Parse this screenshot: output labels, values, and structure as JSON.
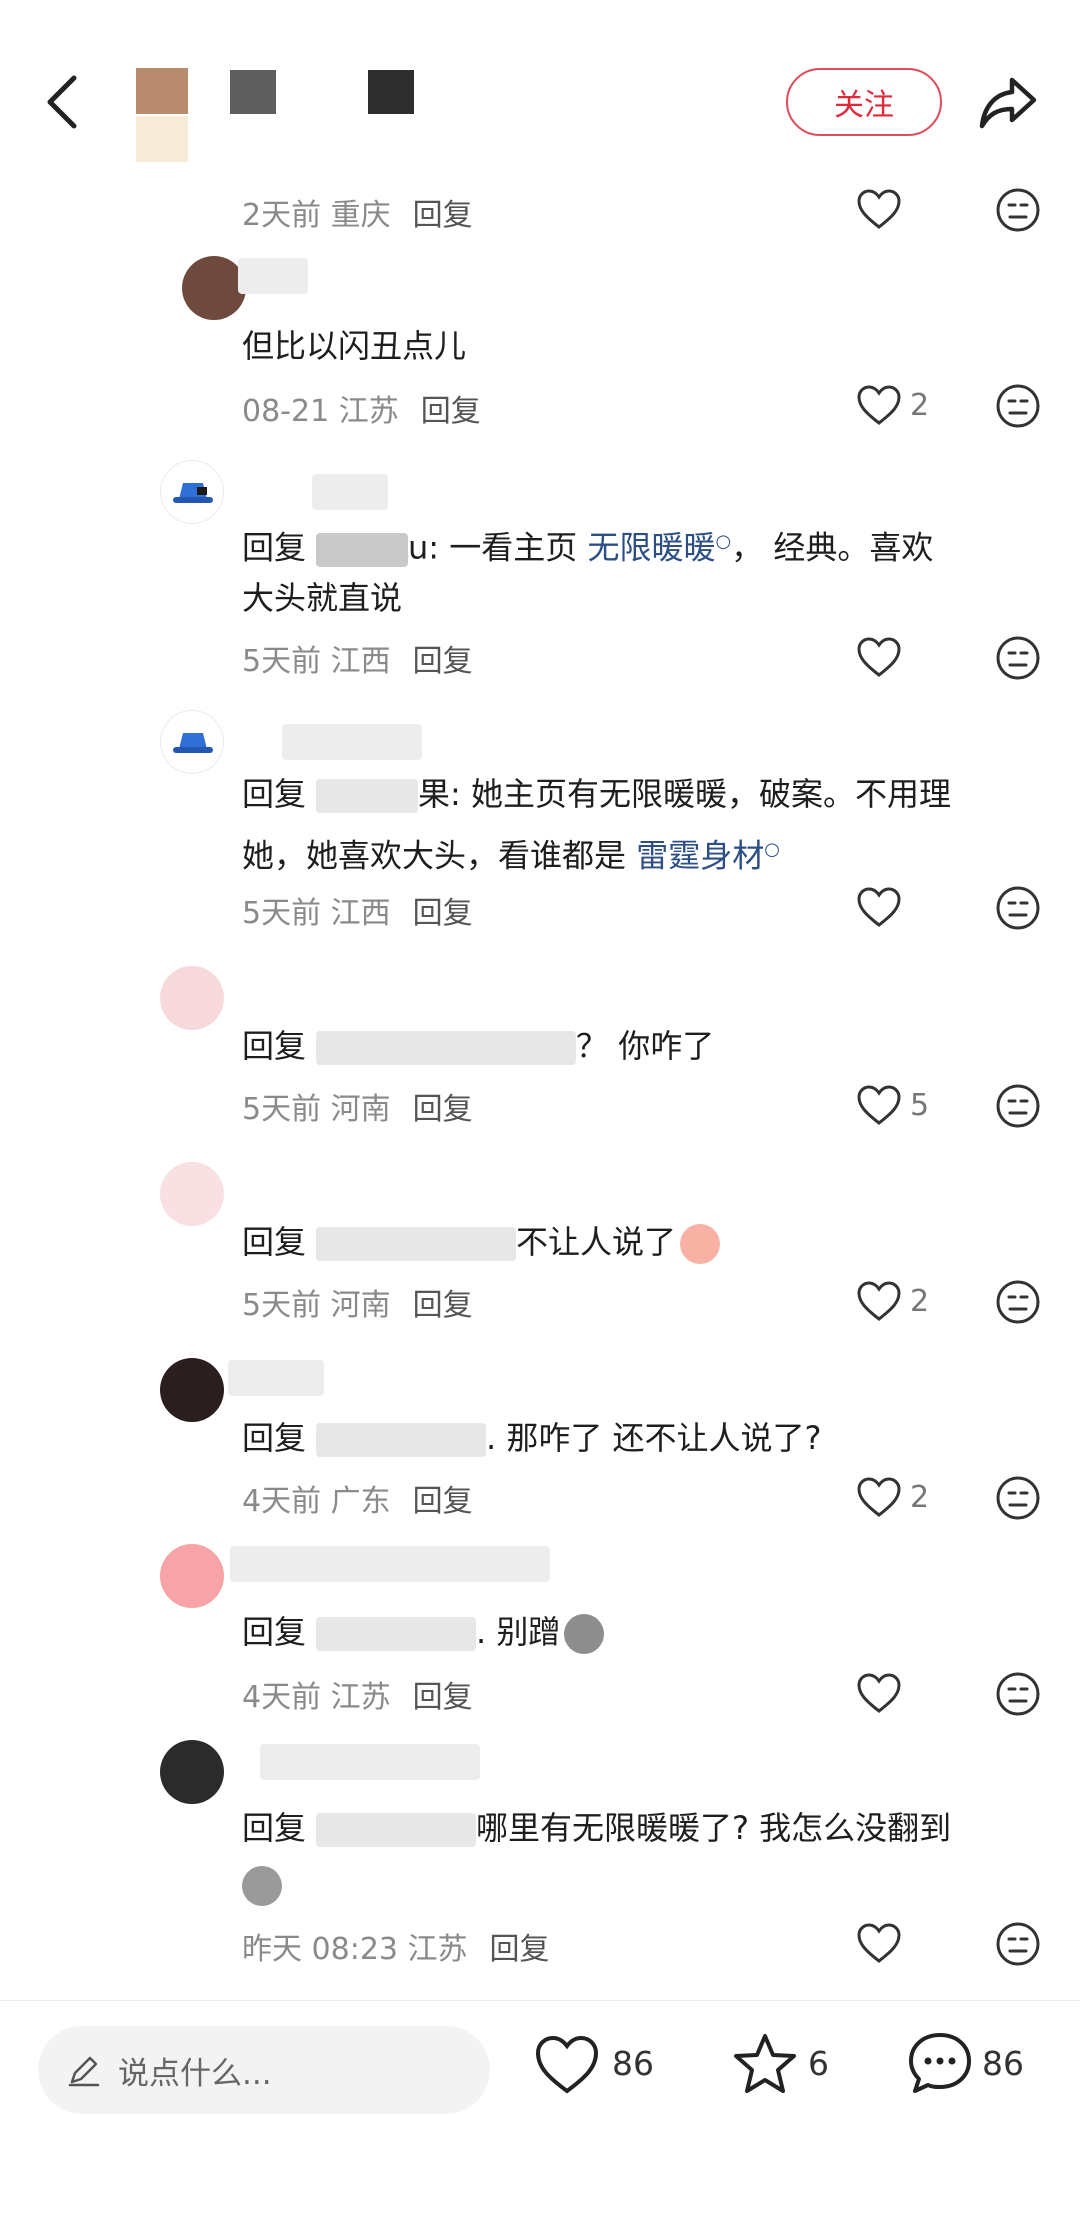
{
  "header": {
    "follow_label": "关注"
  },
  "reply_label": "回复",
  "comments": [
    {
      "time": "2天前",
      "location": "重庆"
    },
    {
      "text": "但比以闪丑点儿",
      "time": "08-21",
      "location": "江苏",
      "likes": "2"
    },
    {
      "reply_prefix": "回复",
      "text_tail": "u: 一看主页 ",
      "link": "无限暖暖",
      "text_after": "， 经典。喜欢",
      "text_line2": "大头就直说",
      "time": "5天前",
      "location": "江西"
    },
    {
      "reply_prefix": "回复",
      "text_tail": "果: 她主页有无限暖暖，破案。不用理",
      "text_line2a": "她，她喜欢大头，看谁都是 ",
      "link": "雷霆身材",
      "time": "5天前",
      "location": "江西"
    },
    {
      "reply_prefix": "回复",
      "text_tail": "？ 你咋了",
      "time": "5天前",
      "location": "河南",
      "likes": "5"
    },
    {
      "reply_prefix": "回复",
      "text_tail": "不让人说了",
      "time": "5天前",
      "location": "河南",
      "likes": "2"
    },
    {
      "reply_prefix": "回复",
      "text_tail": ". 那咋了 还不让人说了?",
      "time": "4天前",
      "location": "广东",
      "likes": "2"
    },
    {
      "reply_prefix": "回复",
      "text_tail": ". 别蹭",
      "time": "4天前",
      "location": "江苏"
    },
    {
      "reply_prefix": "回复",
      "text_tail": "哪里有无限暖暖了? 我怎么没翻到",
      "time": "昨天 08:23",
      "location": "江苏"
    }
  ],
  "bottom": {
    "placeholder": "说点什么...",
    "likes": "86",
    "stars": "6",
    "comments": "86"
  },
  "colors": {
    "accent": "#e02a3c",
    "link": "#2e4f84",
    "meta": "#8a8a8a"
  },
  "icons": [
    "back-icon",
    "share-icon",
    "heart-icon",
    "meh-face-icon",
    "pencil-icon",
    "star-icon",
    "comment-bubble-icon"
  ]
}
